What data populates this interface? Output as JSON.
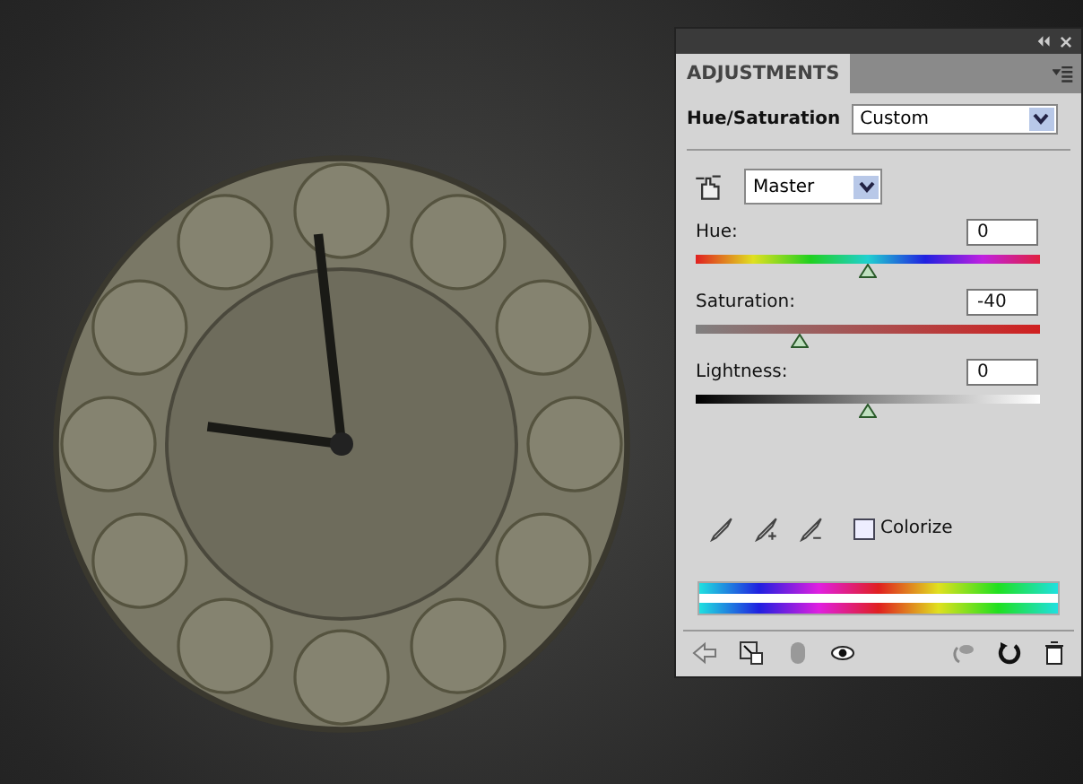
{
  "panel": {
    "tab": "ADJUSTMENTS",
    "preset_label": "Hue/Saturation",
    "preset": "Custom",
    "channel": "Master",
    "sliders": [
      {
        "kind": "hue",
        "label": "Hue:",
        "value": "0",
        "level": 0.5
      },
      {
        "kind": "saturation",
        "label": "Saturation:",
        "value": "-40",
        "level": 0.3
      },
      {
        "kind": "lightness",
        "label": "Lightness:",
        "value": "0",
        "level": 0.5
      }
    ],
    "colorize": {
      "label": "Colorize",
      "checked": false
    }
  }
}
